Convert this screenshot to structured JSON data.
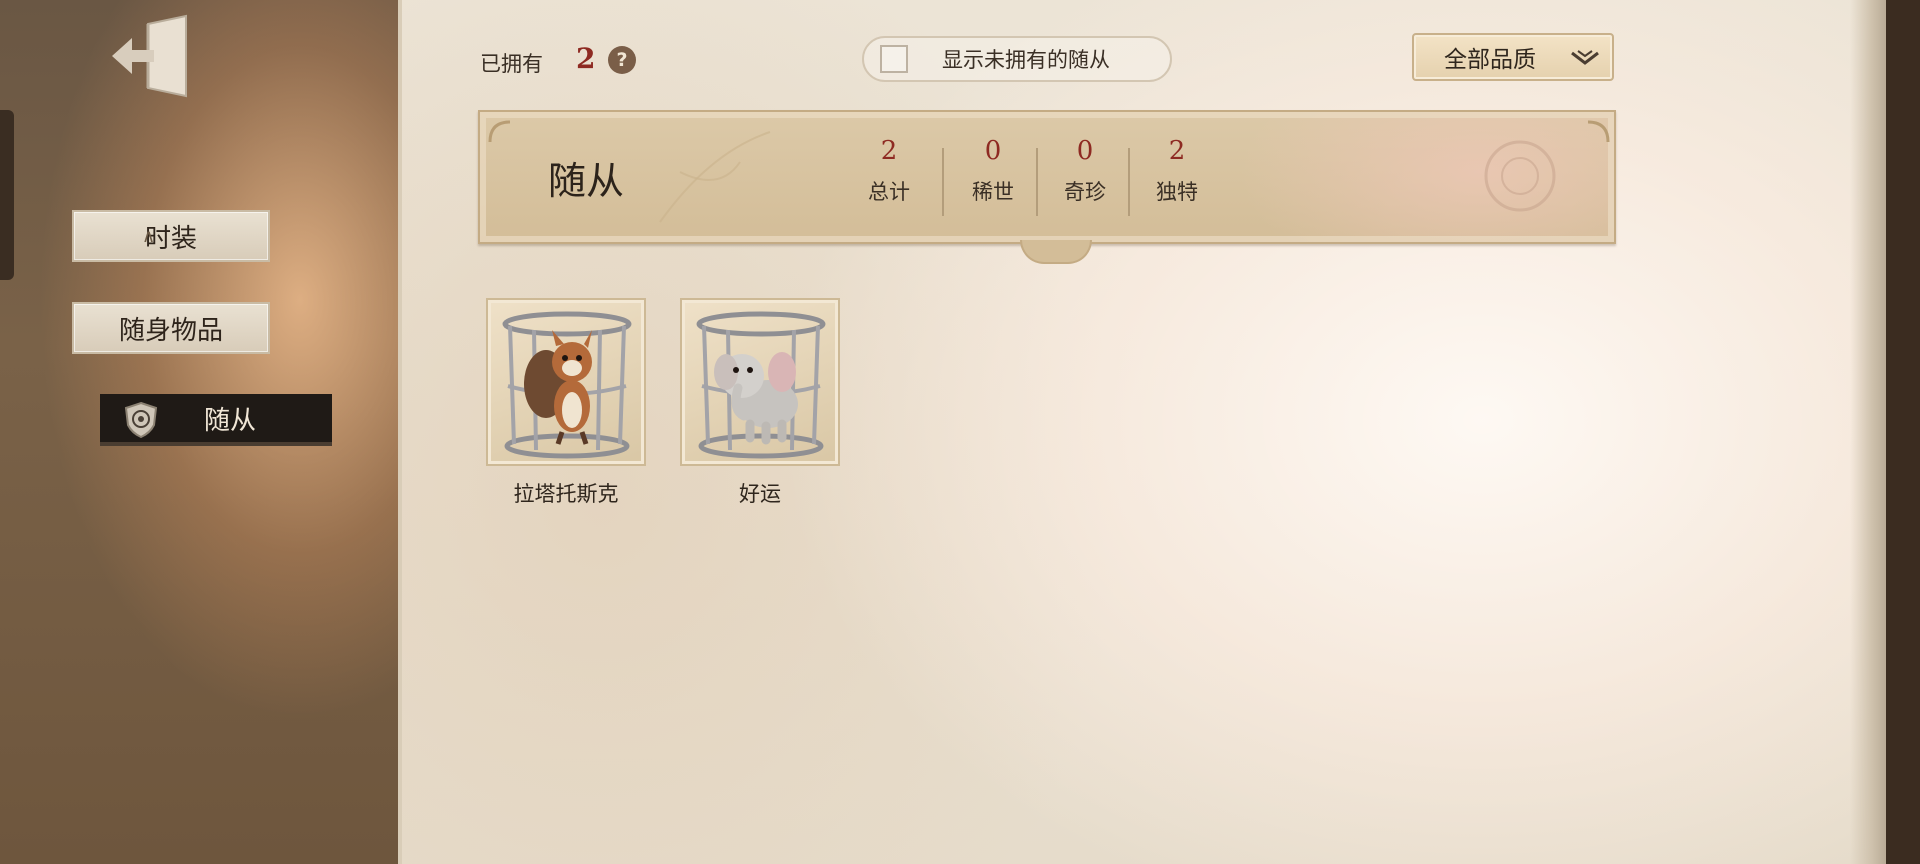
{
  "sidebar": {
    "tabs": [
      {
        "label": "时装"
      },
      {
        "label": "随身物品"
      },
      {
        "label": "随从"
      }
    ]
  },
  "header": {
    "owned_label": "已拥有",
    "owned_count": "2",
    "show_unowned_label": "显示未拥有的随从",
    "show_unowned_checked": false,
    "quality_filter": "全部品质"
  },
  "summary": {
    "title": "随从",
    "stats": [
      {
        "value": "2",
        "label": "总计"
      },
      {
        "value": "0",
        "label": "稀世"
      },
      {
        "value": "0",
        "label": "奇珍"
      },
      {
        "value": "2",
        "label": "独特"
      }
    ]
  },
  "followers": [
    {
      "name": "拉塔托斯克",
      "icon": "squirrel-in-cage-icon"
    },
    {
      "name": "好运",
      "icon": "elephant-in-cage-icon"
    }
  ],
  "colors": {
    "accent_red": "#8e2a22",
    "active_tab_bg": "#1f1a16"
  }
}
